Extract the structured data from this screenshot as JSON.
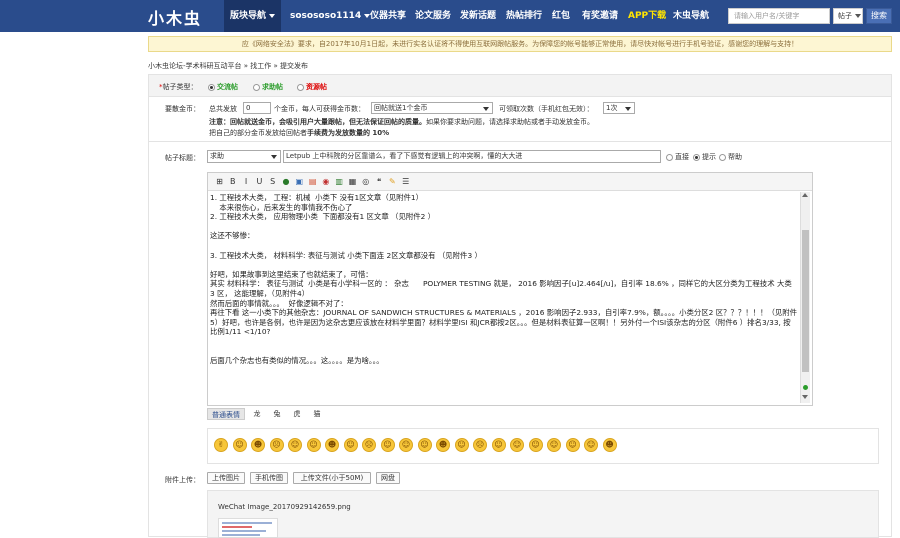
{
  "header": {
    "logo": "小木虫",
    "nav": [
      {
        "label": "版块导航",
        "active": true,
        "has_menu": true
      },
      {
        "label": "sosososo1114",
        "has_menu": true
      },
      {
        "label": "仪器共享"
      },
      {
        "label": "论文服务"
      },
      {
        "label": "发新话题"
      },
      {
        "label": "热帖排行"
      },
      {
        "label": "红包"
      },
      {
        "label": "有奖邀请"
      },
      {
        "label": "APP下载",
        "highlight": true
      },
      {
        "label": "木虫导航"
      }
    ],
    "search_placeholder": "请输入用户名/关键字",
    "search_type": "帖子",
    "search_button": "搜索"
  },
  "notice": "应《网络安全法》要求，自2017年10月1日起，未进行实名认证将不得使用互联网跟帖服务。为保障您的帐号能够正常使用，请尽快对帐号进行手机号验证，感谢您的理解与支持！",
  "breadcrumb": "小木虫论坛-学术科研互动平台 » 找工作 » 提交发布",
  "post_type": {
    "label": "帖子类型：",
    "options": [
      {
        "label": "交流帖",
        "checked": true,
        "style": "green"
      },
      {
        "label": "求助帖",
        "checked": false,
        "style": "green"
      },
      {
        "label": "资源帖",
        "checked": false,
        "style": "red"
      }
    ]
  },
  "reward": {
    "label": "要散金币：",
    "total_label": "总共发放",
    "total_value": "0",
    "per_label": "个金币，每人可获得金币数：",
    "per_value": "回帖就送1个金币",
    "times_label": "可领取次数（手机红包无效）：",
    "times_value": "1次",
    "note1_bold": "注意：回帖就送金币，会吸引用户大量跟帖，但无法保证回帖的质量。",
    "note1_rest": "如果你要求助问题，请选择求助帖或者手动发放金币。",
    "note2": "把自己的部分金币发放给回帖者",
    "note2_bold": "手续费为发放数量的 10%"
  },
  "title_row": {
    "label": "帖子标题：",
    "category": "求助",
    "title_value": "Letpub 上中科院的分区靠谱么，看了下感觉有逻辑上的冲突啊，懂的大大进",
    "modes": [
      {
        "label": "直接",
        "checked": false
      },
      {
        "label": "提示",
        "checked": true
      },
      {
        "label": "帮助",
        "checked": false
      }
    ]
  },
  "editor": {
    "toolbar_icons": [
      "source-icon",
      "bold-icon",
      "italic-icon",
      "underline-icon",
      "strikethrough-icon",
      "color-icon",
      "image-icon",
      "flash-icon",
      "media-icon",
      "attachment-icon",
      "table-icon",
      "code-icon",
      "quote-icon",
      "hide-icon",
      "list-icon"
    ],
    "lines": [
      "1. 工程技术大类， 工程：机械  小类下 没有1区文章（见附件1）",
      "    本来很伤心，后来发生的事情我不伤心了",
      "2. 工程技术大类， 应用物理小类  下面都没有1 区文章 （见附件2 ）",
      "",
      "这还不够惨：",
      "",
      "3. 工程技术大类， 材料科学: 表征与测试 小类下面连 2区文章都没有 （见附件3 ）",
      "",
      "好吧，如果故事到这里结束了也就结束了，可惜：",
      "其实 材料科学： 表征与测试  小类是有小学科一区的 ： 杂志      POLYMER TESTING 就是， 2016 影响因子[u]2.464[/u]，自引率 18.6% ，同样它的大区分类为工程技术 大类 3 区， 这能理解，（见附件4）",
      "然而后面的事情就。。。  好像逻辑不对了：",
      "再往下看 这一小类下的其他杂志：JOURNAL OF SANDWICH STRUCTURES & MATERIALS ，2016 影响因子2.933，自引率7.9%，额。。。。小类分区2 区？？？！！！（见附件5）好吧，也许是各例，也许是因为这杂志更应该放在材料学里面？材料学里ISI 和JCR都按2区。。。但是材料表征算一区啊！！另外付一个ISI该杂志的分区（附件6 ）排名3/33, 按比例1/11 <1/10?",
      "",
      "",
      "后面几个杂志也有类似的情况。。。这。。。。是为啥。。。"
    ]
  },
  "emoji_tabs": [
    {
      "label": "普通表情",
      "active": true
    },
    {
      "label": "龙"
    },
    {
      "label": "兔"
    },
    {
      "label": "虎"
    },
    {
      "label": "猫"
    }
  ],
  "emojis": [
    "✌",
    "☺",
    "☻",
    "☹",
    "☺",
    "☺",
    "☻",
    "☺",
    "☹",
    "☺",
    "☺",
    "☺",
    "☻",
    "☺",
    "☹",
    "☺",
    "☺",
    "☺",
    "☺",
    "☺",
    "☺",
    "☻"
  ],
  "attachments": {
    "label": "附件上传：",
    "buttons": [
      "上传图片",
      "手机传图",
      "上传文件(小于50M)",
      "网盘"
    ],
    "file_name": "WeChat Image_20170929142659.png"
  }
}
